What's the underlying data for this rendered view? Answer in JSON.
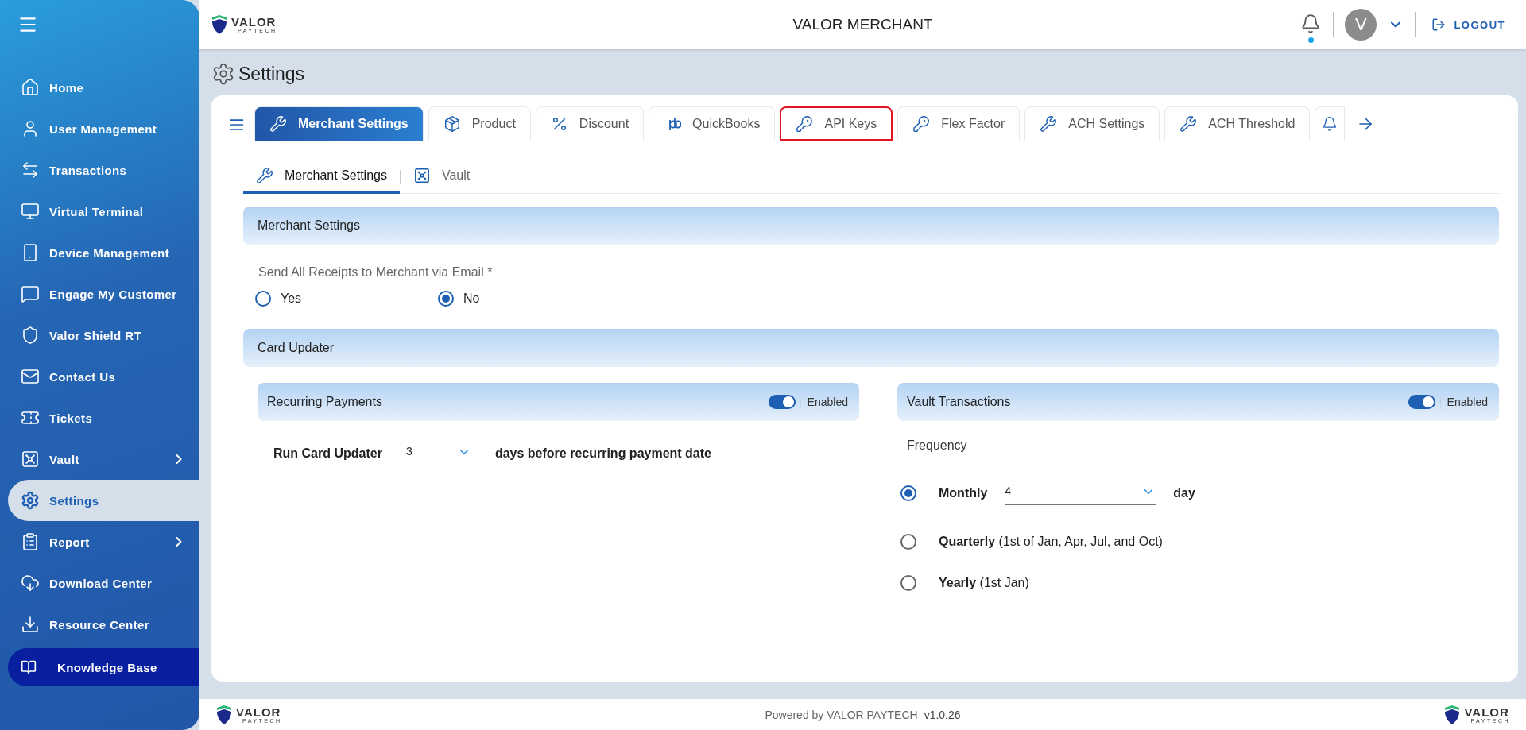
{
  "sidebar": {
    "items": [
      {
        "label": "Home",
        "selected": false,
        "has_submenu": false
      },
      {
        "label": "User Management",
        "selected": false,
        "has_submenu": false
      },
      {
        "label": "Transactions",
        "selected": false,
        "has_submenu": false
      },
      {
        "label": "Virtual Terminal",
        "selected": false,
        "has_submenu": false
      },
      {
        "label": "Device Management",
        "selected": false,
        "has_submenu": false
      },
      {
        "label": "Engage My Customer",
        "selected": false,
        "has_submenu": false
      },
      {
        "label": "Valor Shield RT",
        "selected": false,
        "has_submenu": false
      },
      {
        "label": "Contact Us",
        "selected": false,
        "has_submenu": false
      },
      {
        "label": "Tickets",
        "selected": false,
        "has_submenu": false
      },
      {
        "label": "Vault",
        "selected": false,
        "has_submenu": true
      },
      {
        "label": "Settings",
        "selected": true,
        "has_submenu": false
      },
      {
        "label": "Report",
        "selected": false,
        "has_submenu": true
      },
      {
        "label": "Download Center",
        "selected": false,
        "has_submenu": false
      },
      {
        "label": "Resource Center",
        "selected": false,
        "has_submenu": false
      }
    ],
    "footer_link": {
      "label": "Knowledge Base"
    }
  },
  "header": {
    "logo": {
      "name": "VALOR",
      "tagline": "PAYTECH"
    },
    "title": "VALOR MERCHANT",
    "notification_dot": true,
    "avatar": "V",
    "logout": "LOGOUT"
  },
  "page_title": "Settings",
  "tabs": [
    {
      "label": "Merchant Settings",
      "selected": true,
      "outlined": false
    },
    {
      "label": "Product",
      "selected": false,
      "outlined": false
    },
    {
      "label": "Discount",
      "selected": false,
      "outlined": false
    },
    {
      "label": "QuickBooks",
      "selected": false,
      "outlined": false
    },
    {
      "label": "API Keys",
      "selected": false,
      "outlined": true
    },
    {
      "label": "Flex Factor",
      "selected": false,
      "outlined": false
    },
    {
      "label": "ACH Settings",
      "selected": false,
      "outlined": false
    },
    {
      "label": "ACH Threshold",
      "selected": false,
      "outlined": false
    }
  ],
  "subtabs": [
    {
      "label": "Merchant Settings",
      "selected": true
    },
    {
      "label": "Vault",
      "selected": false
    }
  ],
  "merchant_section": {
    "title": "Merchant Settings",
    "question": "Send All Receipts to Merchant via Email *",
    "options": [
      {
        "label": "Yes",
        "selected": false
      },
      {
        "label": "No",
        "selected": true
      }
    ]
  },
  "card_updater": {
    "title": "Card Updater",
    "recurring": {
      "title": "Recurring Payments",
      "on": true,
      "status": "Enabled",
      "label": "Run Card Updater",
      "value": "3",
      "suffix": "days before recurring payment date"
    },
    "vault": {
      "title": "Vault Transactions",
      "on": true,
      "status": "Enabled",
      "frequency_label": "Frequency",
      "options": [
        {
          "kind": "select",
          "label": "Monthly",
          "value": "4",
          "suffix": "day",
          "selected": true
        },
        {
          "kind": "text",
          "label": "Quarterly",
          "note": "(1st of Jan, Apr, Jul, and Oct)",
          "selected": false
        },
        {
          "kind": "text",
          "label": "Yearly",
          "note": "(1st Jan)",
          "selected": false
        }
      ]
    }
  },
  "footer": {
    "logo_left": {
      "name": "VALOR",
      "tagline": "PAYTECH"
    },
    "text": "Powered by VALOR PAYTECH",
    "version": "v1.0.26",
    "logo_right": {
      "name": "VALOR",
      "tagline": "PAYTECH"
    }
  }
}
